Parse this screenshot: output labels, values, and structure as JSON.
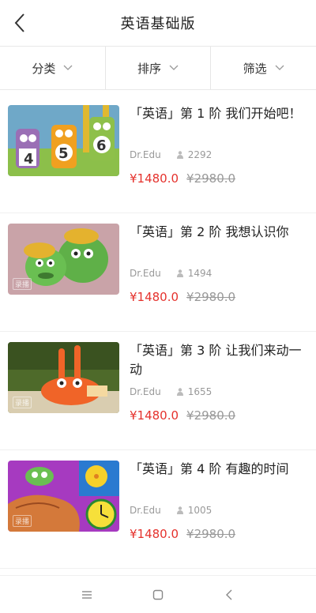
{
  "header": {
    "title": "英语基础版",
    "back_icon": "chevron-left-icon"
  },
  "filters": [
    {
      "label": "分类",
      "icon": "chevron-down-icon"
    },
    {
      "label": "排序",
      "icon": "chevron-down-icon"
    },
    {
      "label": "筛选",
      "icon": "chevron-down-icon"
    }
  ],
  "courses": [
    {
      "title": "「英语」第 1 阶 我们开始吧！",
      "author": "Dr.Edu",
      "students": "2292",
      "price": "¥1480.0",
      "original_price": "¥2980.0"
    },
    {
      "title": "「英语」第 2 阶 我想认识你",
      "author": "Dr.Edu",
      "students": "1494",
      "price": "¥1480.0",
      "original_price": "¥2980.0",
      "thumb_tag": "录播"
    },
    {
      "title": "「英语」第 3 阶 让我们来动一动",
      "author": "Dr.Edu",
      "students": "1655",
      "price": "¥1480.0",
      "original_price": "¥2980.0",
      "thumb_tag": "录播"
    },
    {
      "title": "「英语」第 4 阶 有趣的时间",
      "author": "Dr.Edu",
      "students": "1005",
      "price": "¥1480.0",
      "original_price": "¥2980.0",
      "thumb_tag": "录播"
    }
  ],
  "colors": {
    "price": "#e5322d",
    "muted": "#999999",
    "text": "#222222"
  },
  "navbar": {
    "icons": [
      "menu-icon",
      "home-square-icon",
      "back-triangle-icon"
    ]
  }
}
